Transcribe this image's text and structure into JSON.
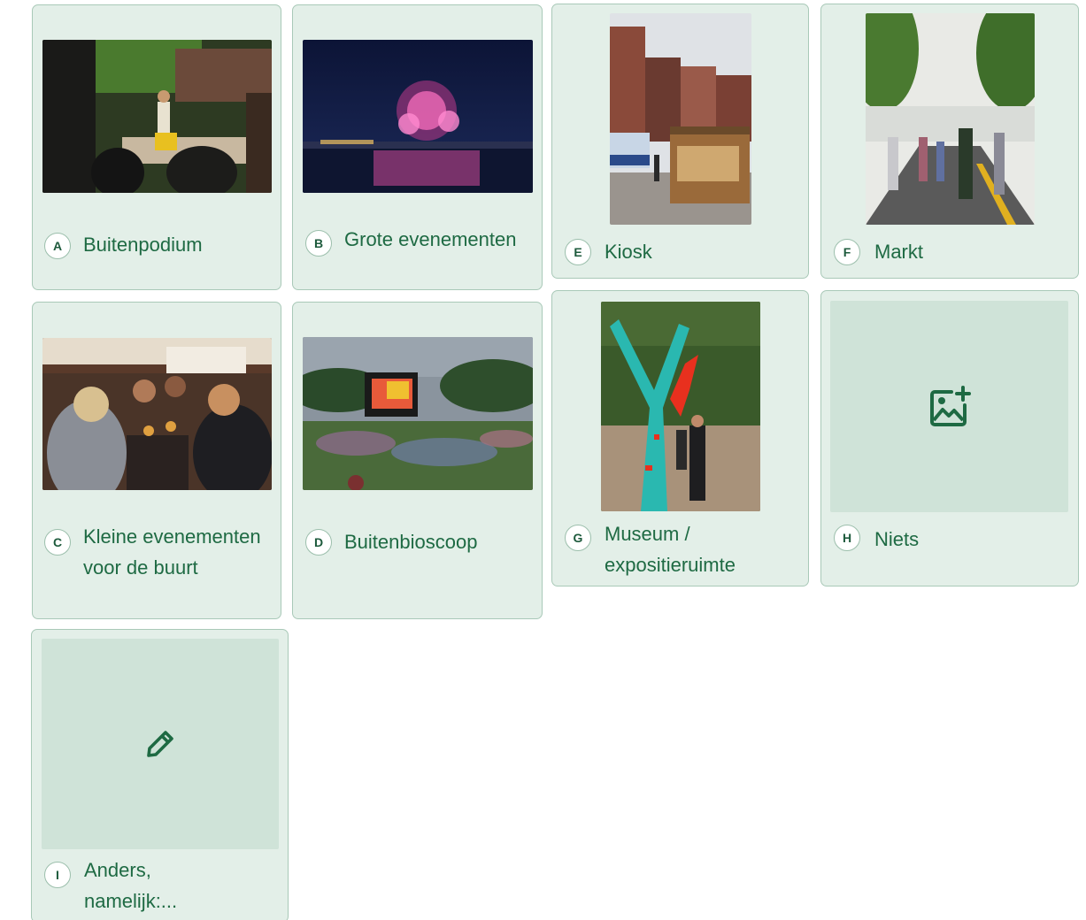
{
  "colors": {
    "card_bg": "#e3efe8",
    "card_border": "#a9c9b8",
    "placeholder_bg": "#cfe3d8",
    "label_text": "#1e6a43",
    "icon": "#1e6a43"
  },
  "options": [
    {
      "key": "A",
      "label": "Buitenpodium",
      "image": "photo-outdoor-stage-performer"
    },
    {
      "key": "B",
      "label": "Grote evenementen",
      "image": "photo-fireworks-over-water"
    },
    {
      "key": "C",
      "label": "Kleine evenementen voor de buurt",
      "image": "photo-people-dining-at-table"
    },
    {
      "key": "D",
      "label": "Buitenbioscoop",
      "image": "photo-outdoor-cinema-on-lawn"
    },
    {
      "key": "E",
      "label": "Kiosk",
      "image": "photo-kiosk-on-street"
    },
    {
      "key": "F",
      "label": "Markt",
      "image": "photo-street-market"
    },
    {
      "key": "G",
      "label": "Museum / expositieruimte",
      "image": "photo-decorated-tree-exhibit"
    },
    {
      "key": "H",
      "label": "Niets",
      "image": "add-image-icon"
    },
    {
      "key": "I",
      "label": "Anders, namelijk:...",
      "image": "pencil-icon"
    }
  ]
}
